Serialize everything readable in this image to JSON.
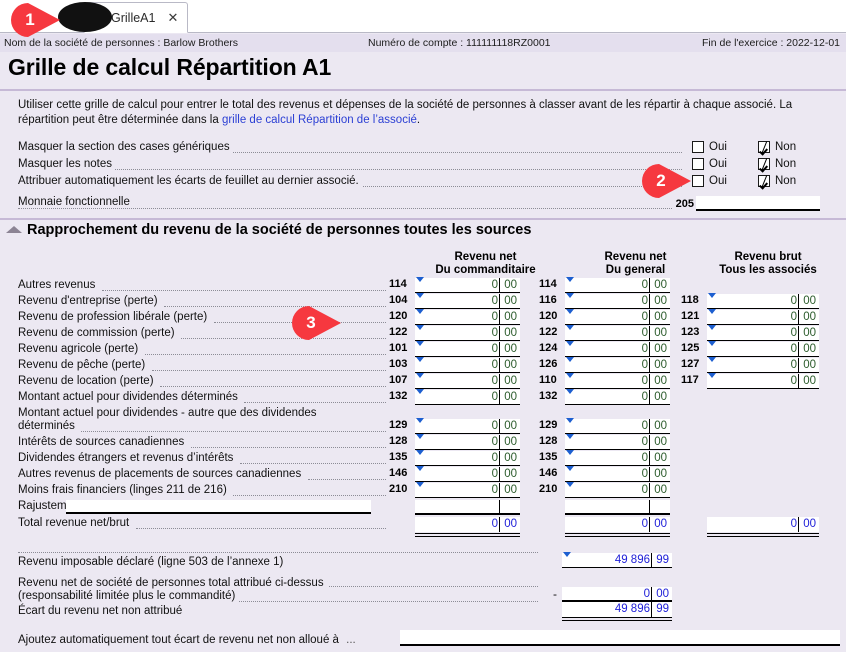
{
  "tab": {
    "label": "GrilleA1",
    "close_label": "✕",
    "icon": "document-icon"
  },
  "infobar": {
    "company": "Nom de la société de personnes : Barlow Brothers",
    "account": "Numéro de compte : 111111118RZ0001",
    "yearend": "Fin de l'exercice : 2022-12-01"
  },
  "page_title": "Grille de calcul Répartition A1",
  "intro": {
    "part1": "Utiliser cette grille de calcul pour entrer le total des revenus et dépenses de la société de personnes à classer avant de les répartir à chaque associé. La répartition peut être déterminée dans la ",
    "link": "grille de calcul Répartition de l’associé",
    "part2": "."
  },
  "options": {
    "yes_label": "Oui",
    "no_label": "Non",
    "rows": [
      {
        "label": "Masquer la section des cases génériques",
        "yes": false,
        "no": true
      },
      {
        "label": "Masquer les notes",
        "yes": false,
        "no": true
      },
      {
        "label": "Attribuer automatiquement les écarts de feuillet au dernier associé.",
        "yes": false,
        "no": true
      }
    ]
  },
  "monnaie": {
    "label": "Monnaie fonctionnelle",
    "code": "205",
    "value": ""
  },
  "section": {
    "title": "Rapprochement du revenu de la société de personnes toutes les sources",
    "collapse_icon": "caret-up-icon"
  },
  "columns": [
    {
      "line1": "Revenu net",
      "line2": "Du commanditaire"
    },
    {
      "line1": "Revenu net",
      "line2": "Du general"
    },
    {
      "line1": "Revenu brut",
      "line2": "Tous les associés"
    }
  ],
  "rows": [
    {
      "label": "Autres revenus",
      "c1": {
        "code": "114",
        "d": "0",
        "c": "00"
      },
      "c2": {
        "code": "114",
        "d": "0",
        "c": "00"
      },
      "c3": null
    },
    {
      "label": "Revenu d'entreprise (perte)",
      "c1": {
        "code": "104",
        "d": "0",
        "c": "00"
      },
      "c2": {
        "code": "116",
        "d": "0",
        "c": "00"
      },
      "c3": {
        "code": "118",
        "d": "0",
        "c": "00"
      }
    },
    {
      "label": "Revenu de profession libérale (perte)",
      "c1": {
        "code": "120",
        "d": "0",
        "c": "00"
      },
      "c2": {
        "code": "120",
        "d": "0",
        "c": "00"
      },
      "c3": {
        "code": "121",
        "d": "0",
        "c": "00"
      }
    },
    {
      "label": "Revenu de commission (perte)",
      "c1": {
        "code": "122",
        "d": "0",
        "c": "00"
      },
      "c2": {
        "code": "122",
        "d": "0",
        "c": "00"
      },
      "c3": {
        "code": "123",
        "d": "0",
        "c": "00"
      }
    },
    {
      "label": "Revenu agricole (perte)",
      "c1": {
        "code": "101",
        "d": "0",
        "c": "00"
      },
      "c2": {
        "code": "124",
        "d": "0",
        "c": "00"
      },
      "c3": {
        "code": "125",
        "d": "0",
        "c": "00"
      }
    },
    {
      "label": "Revenu de pêche (perte)",
      "c1": {
        "code": "103",
        "d": "0",
        "c": "00"
      },
      "c2": {
        "code": "126",
        "d": "0",
        "c": "00"
      },
      "c3": {
        "code": "127",
        "d": "0",
        "c": "00"
      }
    },
    {
      "label": "Revenu de location (perte)",
      "c1": {
        "code": "107",
        "d": "0",
        "c": "00"
      },
      "c2": {
        "code": "110",
        "d": "0",
        "c": "00"
      },
      "c3": {
        "code": "117",
        "d": "0",
        "c": "00"
      }
    },
    {
      "label": "Montant actuel pour dividendes déterminés",
      "c1": {
        "code": "132",
        "d": "0",
        "c": "00"
      },
      "c2": {
        "code": "132",
        "d": "0",
        "c": "00"
      },
      "c3": null
    },
    {
      "label": "Montant actuel pour dividendes - autre que des dividendes",
      "label2": "déterminés",
      "c1": {
        "code": "129",
        "d": "0",
        "c": "00"
      },
      "c2": {
        "code": "129",
        "d": "0",
        "c": "00"
      },
      "c3": null
    },
    {
      "label": "Intérêts de sources canadiennes",
      "c1": {
        "code": "128",
        "d": "0",
        "c": "00"
      },
      "c2": {
        "code": "128",
        "d": "0",
        "c": "00"
      },
      "c3": null
    },
    {
      "label": "Dividendes étrangers et revenus d’intérêts",
      "c1": {
        "code": "135",
        "d": "0",
        "c": "00"
      },
      "c2": {
        "code": "135",
        "d": "0",
        "c": "00"
      },
      "c3": null
    },
    {
      "label": "Autres revenus de placements de sources canadiennes",
      "c1": {
        "code": "146",
        "d": "0",
        "c": "00"
      },
      "c2": {
        "code": "146",
        "d": "0",
        "c": "00"
      },
      "c3": null
    },
    {
      "label": "Moins frais financiers (linges 211 de 216)",
      "c1": {
        "code": "210",
        "d": "0",
        "c": "00"
      },
      "c2": {
        "code": "210",
        "d": "0",
        "c": "00"
      },
      "c3": null
    }
  ],
  "rajustement": {
    "label": "Rajustement",
    "value": ""
  },
  "total": {
    "label": "Total revenue net/brut",
    "c1": {
      "d": "0",
      "c": "00"
    },
    "c2": {
      "d": "0",
      "c": "00"
    },
    "c3": {
      "d": "0",
      "c": "00"
    }
  },
  "bottom": {
    "taxable": {
      "label": "Revenu imposable déclaré (ligne 503 de l’annexe 1)",
      "d": "49 896",
      "c": "99"
    },
    "allocated": {
      "label_line1": "Revenu net de société de personnes total attribué ci-dessus",
      "label_line2": "(responsabilité limitée plus le commandité)",
      "sign": "-",
      "d": "0",
      "c": "00"
    },
    "variance": {
      "label": "Écart du revenu net non attribué",
      "d": "49 896",
      "c": "99"
    },
    "auto": {
      "label": "Ajoutez automatiquement tout écart de revenu net non alloué à",
      "dots": "...",
      "value": ""
    }
  },
  "markers": [
    {
      "id": "1",
      "target": "tab"
    },
    {
      "id": "2",
      "target": "auto-allocate-option"
    },
    {
      "id": "3",
      "target": "profession-row"
    }
  ],
  "colors": {
    "page_bg": "#ece8f2",
    "infobar_bg": "#e4dfee",
    "rule": "#c6b9d6",
    "link": "#2b3fd4",
    "green_value": "#2c5c2c",
    "blue_value": "#2020d8",
    "marker_red": "#f6383f",
    "triangle_blue": "#1d5fd0"
  }
}
